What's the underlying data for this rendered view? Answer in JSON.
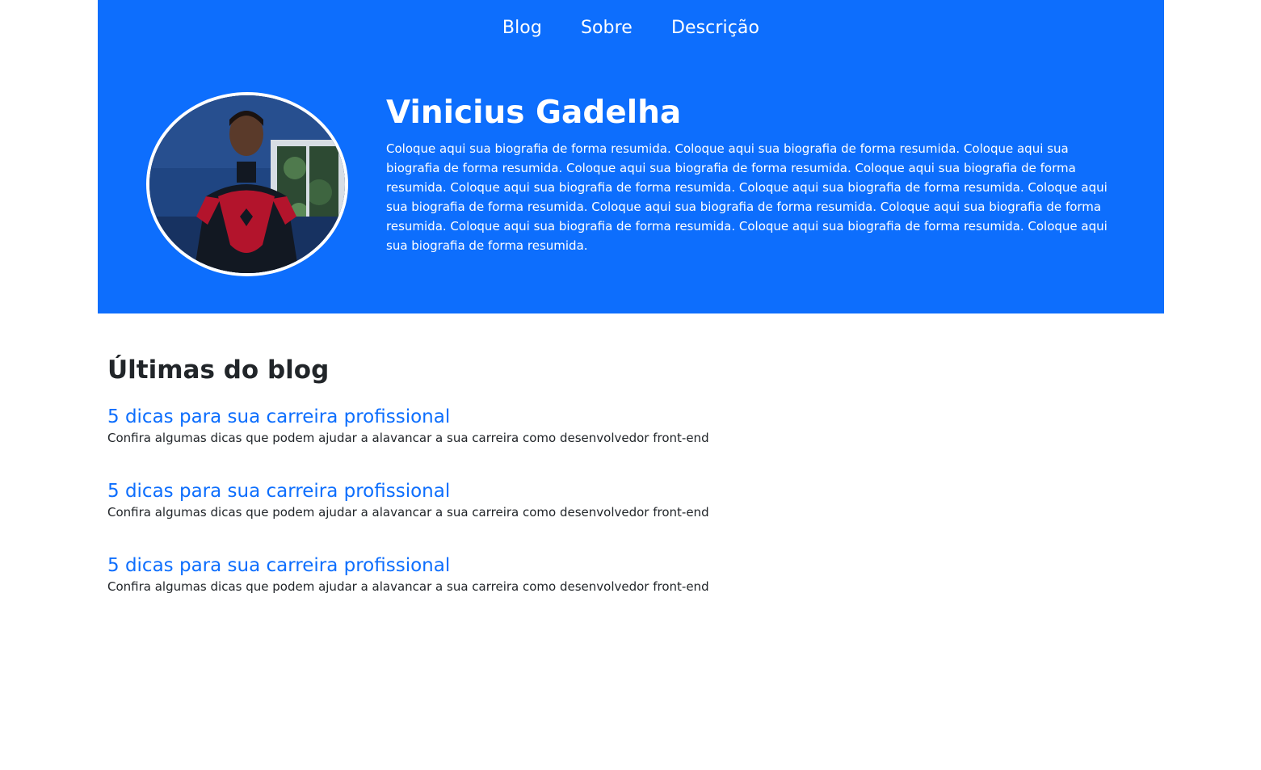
{
  "nav": {
    "items": [
      {
        "label": "Blog"
      },
      {
        "label": "Sobre"
      },
      {
        "label": "Descrição"
      }
    ]
  },
  "profile": {
    "name": "Vinicius Gadelha",
    "bio": "Coloque aqui sua biografia de forma resumida. Coloque aqui sua biografia de forma resumida. Coloque aqui sua biografia de forma resumida. Coloque aqui sua biografia de forma resumida. Coloque aqui sua biografia de forma resumida. Coloque aqui sua biografia de forma resumida. Coloque aqui sua biografia de forma resumida. Coloque aqui sua biografia de forma resumida. Coloque aqui sua biografia de forma resumida. Coloque aqui sua biografia de forma resumida. Coloque aqui sua biografia de forma resumida. Coloque aqui sua biografia de forma resumida. Coloque aqui sua biografia de forma resumida."
  },
  "blog": {
    "heading": "Últimas do blog",
    "posts": [
      {
        "title": "5 dicas para sua carreira profissional",
        "summary": "Confira algumas dicas que podem ajudar a alavancar a sua carreira como desenvolvedor front-end"
      },
      {
        "title": "5 dicas para sua carreira profissional",
        "summary": "Confira algumas dicas que podem ajudar a alavancar a sua carreira como desenvolvedor front-end"
      },
      {
        "title": "5 dicas para sua carreira profissional",
        "summary": "Confira algumas dicas que podem ajudar a alavancar a sua carreira como desenvolvedor front-end"
      }
    ]
  },
  "colors": {
    "primary": "#0d6efd",
    "text": "#212529",
    "background": "#ffffff"
  },
  "icons": {
    "avatar": "profile-photo"
  }
}
